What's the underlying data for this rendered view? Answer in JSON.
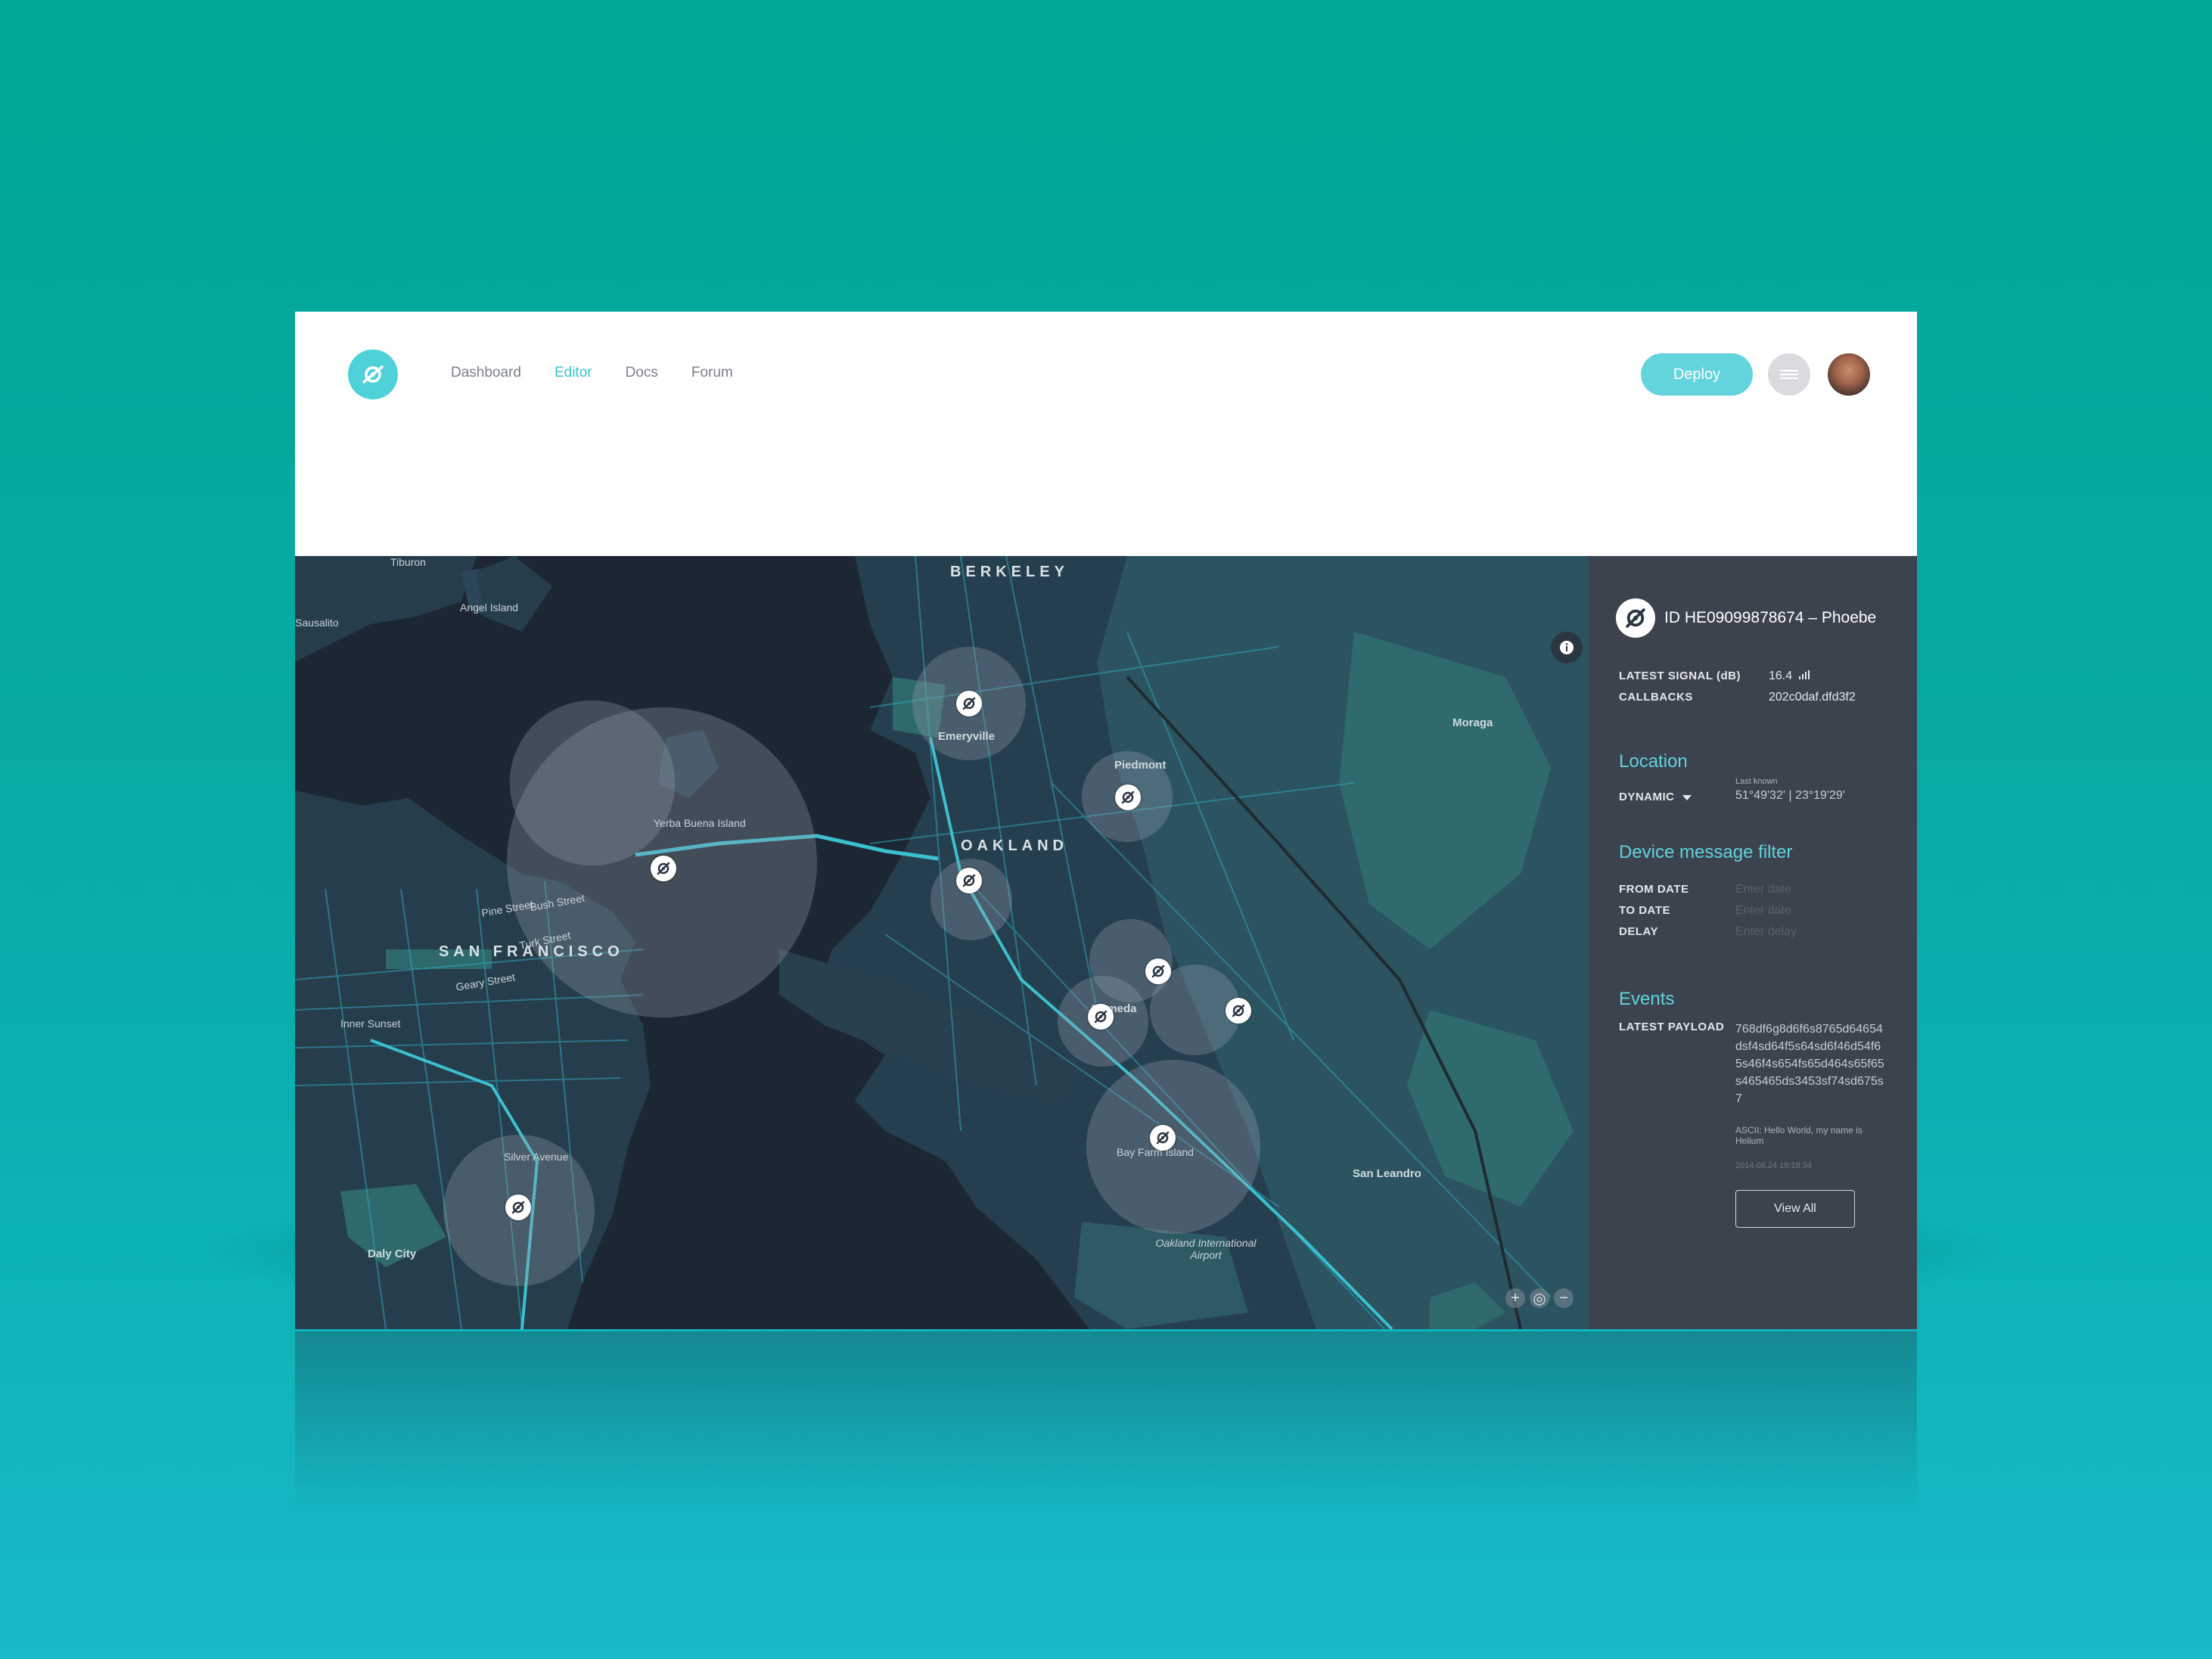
{
  "nav": {
    "items": [
      {
        "label": "Dashboard",
        "active": false
      },
      {
        "label": "Editor",
        "active": true
      },
      {
        "label": "Docs",
        "active": false
      },
      {
        "label": "Forum",
        "active": false
      }
    ]
  },
  "header": {
    "deploy_label": "Deploy",
    "menu_icon": "hamburger-icon",
    "avatar": "user-avatar"
  },
  "map": {
    "labels": {
      "tiburon": "Tiburon",
      "angel_island": "Angel Island",
      "sausalito": "Sausalito",
      "berkeley": "BERKELEY",
      "emeryville": "Emeryville",
      "piedmont": "Piedmont",
      "oakland": "OAKLAND",
      "yerba_buena": "Yerba Buena Island",
      "san_francisco": "SAN FRANCISCO",
      "alameda": "Alameda",
      "moraga": "Moraga",
      "san_leandro": "San Leandro",
      "bay_farm": "Bay Farm Island",
      "oakland_airport": "Oakland International Airport",
      "daly_city": "Daly City",
      "silver_avenue": "Silver Avenue",
      "inner_sunset": "Inner Sunset",
      "pine_street": "Pine Street",
      "bush_street": "Bush Street",
      "turk_street": "Turk Street",
      "geary": "Geary Street"
    },
    "device_icon": "helium-device-icon",
    "colors": {
      "water": "#1c2733",
      "land": "#263f4e",
      "roads": "#2ea6b8",
      "park": "#2e6a6c"
    }
  },
  "panel": {
    "device_title": "ID HE09099878674 – Phoebe",
    "latest_signal_label": "LATEST SIGNAL (dB)",
    "latest_signal_value": "16.4",
    "callbacks_label": "CALLBACKS",
    "callbacks_value": "202c0daf.dfd3f2",
    "location": {
      "title": "Location",
      "mode": "DYNAMIC",
      "last_known_label": "Last known",
      "coords": "51°49'32' | 23°19'29'"
    },
    "filter": {
      "title": "Device message filter",
      "from_label": "FROM DATE",
      "from_placeholder": "Enter date",
      "to_label": "TO DATE",
      "to_placeholder": "Enter date",
      "delay_label": "DELAY",
      "delay_placeholder": "Enter delay"
    },
    "events": {
      "title": "Events",
      "payload_label": "LATEST PAYLOAD",
      "payload": "768df6g8d6f6s8765d64654dsf4sd64f5s64sd6f46d54f65s46f4s654fs65d464s65f65s465465ds3453sf74sd675s7",
      "ascii": "ASCII: Hello World, my name is Helium",
      "timestamp": "2014.08.24 19:18:34",
      "view_all": "View All"
    }
  },
  "accent_color": "#3cc3cf"
}
